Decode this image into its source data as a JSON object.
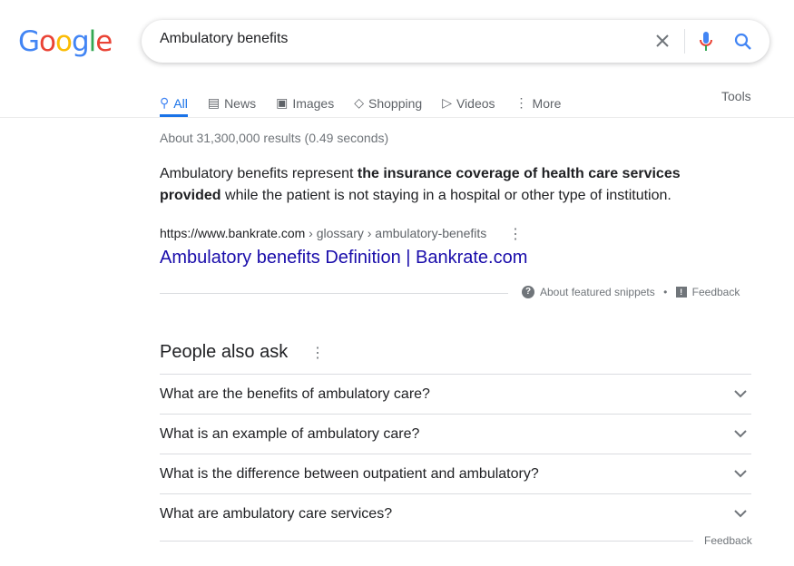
{
  "logo": "Google",
  "colors": {
    "blue": "#4285f4",
    "red": "#ea4335",
    "yellow": "#fbbc05",
    "green": "#34a853",
    "link": "#1a0dab"
  },
  "search": {
    "value": "Ambulatory benefits"
  },
  "tabs": [
    {
      "label": "All",
      "icon": "search-icon"
    },
    {
      "label": "News",
      "icon": "news-icon"
    },
    {
      "label": "Images",
      "icon": "image-icon"
    },
    {
      "label": "Shopping",
      "icon": "tag-icon"
    },
    {
      "label": "Videos",
      "icon": "play-icon"
    },
    {
      "label": "More",
      "icon": "more-vert-icon"
    }
  ],
  "tools": "Tools",
  "stats": "About 31,300,000 results (0.49 seconds)",
  "snippet": {
    "pre": "Ambulatory benefits represent ",
    "bold": "the insurance coverage of health care services provided",
    "post": " while the patient is not staying in a hospital or other type of institution.",
    "cite_domain": "https://www.bankrate.com",
    "cite_path": " › glossary › ambulatory-benefits",
    "title": "Ambulatory benefits Definition | Bankrate.com",
    "about": "About featured snippets",
    "feedback": "Feedback"
  },
  "paa": {
    "heading": "People also ask",
    "questions": [
      "What are the benefits of ambulatory care?",
      "What is an example of ambulatory care?",
      "What is the difference between outpatient and ambulatory?",
      "What are ambulatory care services?"
    ],
    "feedback": "Feedback"
  }
}
